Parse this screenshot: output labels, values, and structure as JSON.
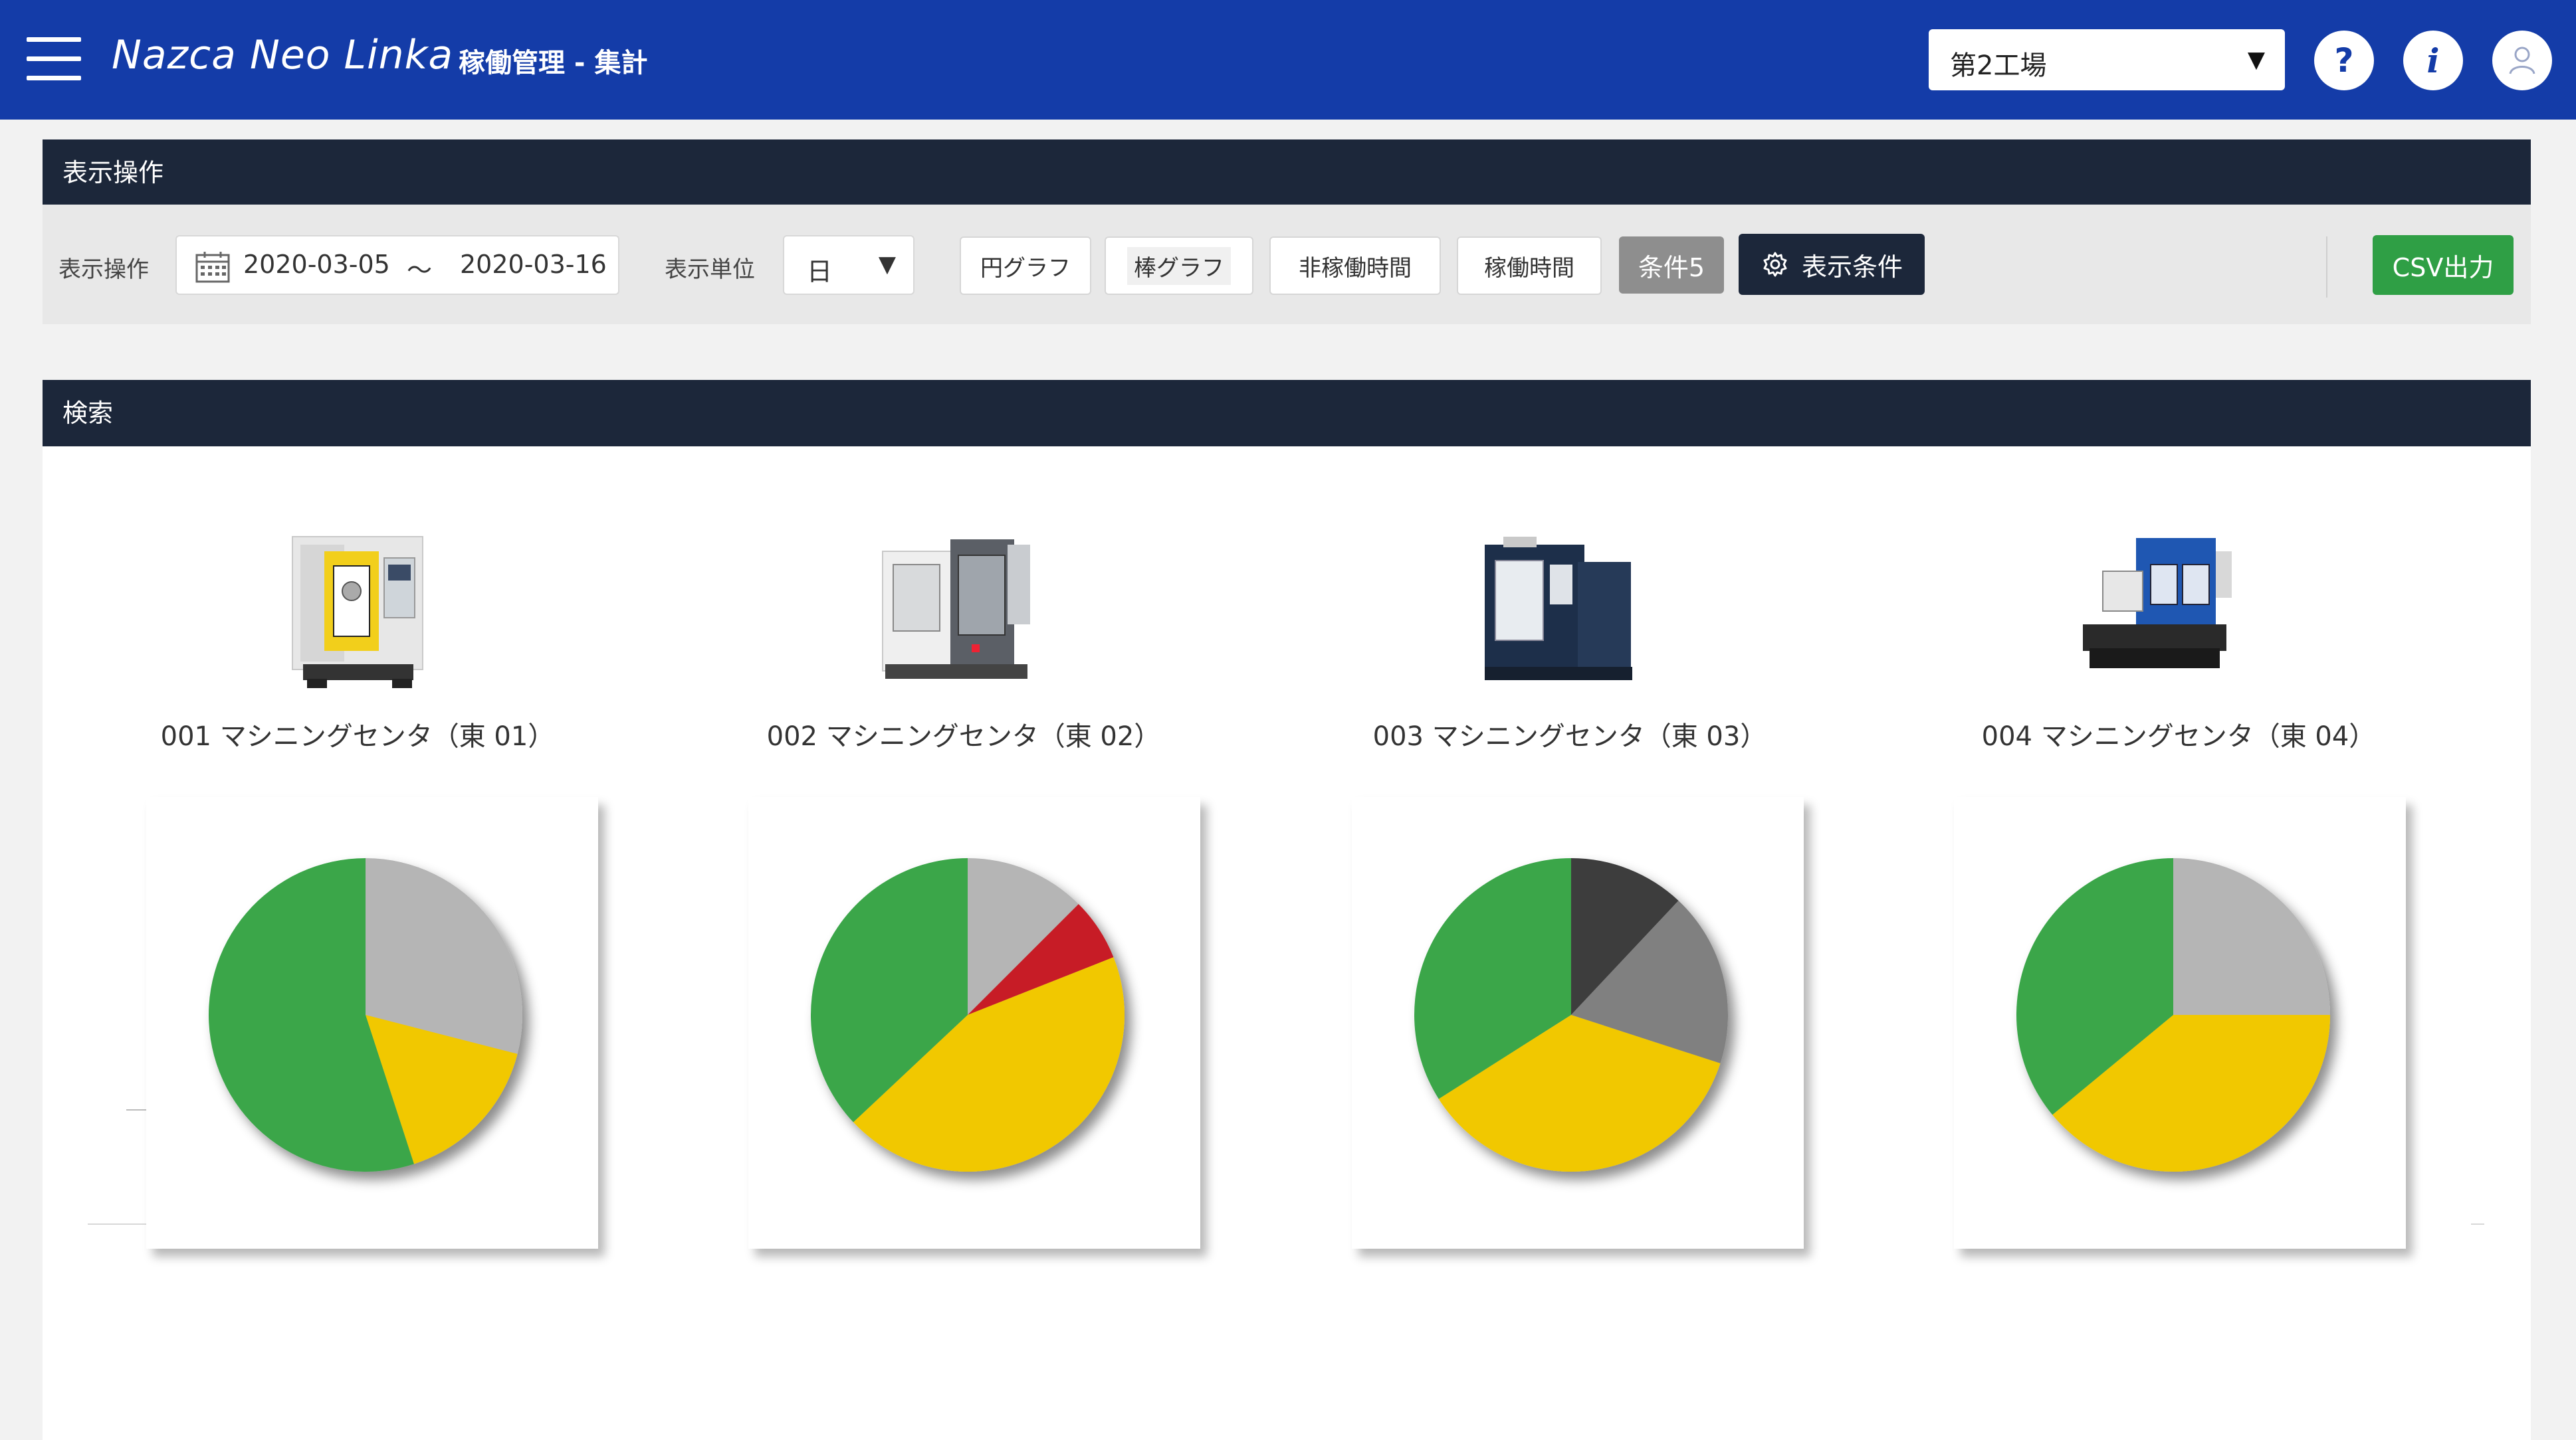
{
  "header": {
    "app_name": "Nazca Neo Linka",
    "page_title": "稼働管理 - 集計",
    "factory": "第2工場",
    "help_icon_text": "?",
    "info_icon_text": "i"
  },
  "display_panel": {
    "title": "表示操作",
    "period_label": "表示操作",
    "date_from": "2020-03-05",
    "date_sep": "～",
    "date_to": "2020-03-16",
    "unit_label": "表示単位",
    "unit_value": "日",
    "buttons": {
      "pie": "円グラフ",
      "bar": "棒グラフ",
      "non_operating": "非稼働時間",
      "operating": "稼働時間",
      "condition": "条件5",
      "settings": "表示条件",
      "csv": "CSV出力"
    }
  },
  "search_panel": {
    "title": "検索"
  },
  "colors": {
    "header_bg": "#143ca8",
    "panel_bar": "#1c273a",
    "green": "#3aa64a",
    "yellow": "#f1c800",
    "light_gray": "#b5b5b5",
    "red": "#c71f25",
    "dark_gray": "#3d3d3d",
    "mid_gray": "#808080",
    "csv_button": "#2f9f45"
  },
  "machines": [
    {
      "name": "001 マシニングセンタ（東 01）",
      "image": "machine-yellow-door"
    },
    {
      "name": "002 マシニングセンタ（東 02）",
      "image": "machine-white-gray"
    },
    {
      "name": "003 マシニングセンタ（東 03）",
      "image": "machine-navy"
    },
    {
      "name": "004 マシニングセンタ（東 04）",
      "image": "machine-blue"
    }
  ],
  "chart_data": [
    {
      "type": "pie",
      "slices": [
        {
          "value": 29,
          "color": "#b5b5b5"
        },
        {
          "value": 16,
          "color": "#f1c800"
        },
        {
          "value": 55,
          "color": "#3aa64a"
        }
      ]
    },
    {
      "type": "pie",
      "slices": [
        {
          "value": 12.5,
          "color": "#b5b5b5"
        },
        {
          "value": 6.5,
          "color": "#c71f25"
        },
        {
          "value": 44,
          "color": "#f1c800"
        },
        {
          "value": 37,
          "color": "#3aa64a"
        }
      ]
    },
    {
      "type": "pie",
      "slices": [
        {
          "value": 12,
          "color": "#3d3d3d"
        },
        {
          "value": 18,
          "color": "#808080"
        },
        {
          "value": 36,
          "color": "#f1c800"
        },
        {
          "value": 34,
          "color": "#3aa64a"
        }
      ]
    },
    {
      "type": "pie",
      "slices": [
        {
          "value": 25,
          "color": "#b5b5b5"
        },
        {
          "value": 39,
          "color": "#f1c800"
        },
        {
          "value": 36,
          "color": "#3aa64a"
        }
      ]
    }
  ]
}
